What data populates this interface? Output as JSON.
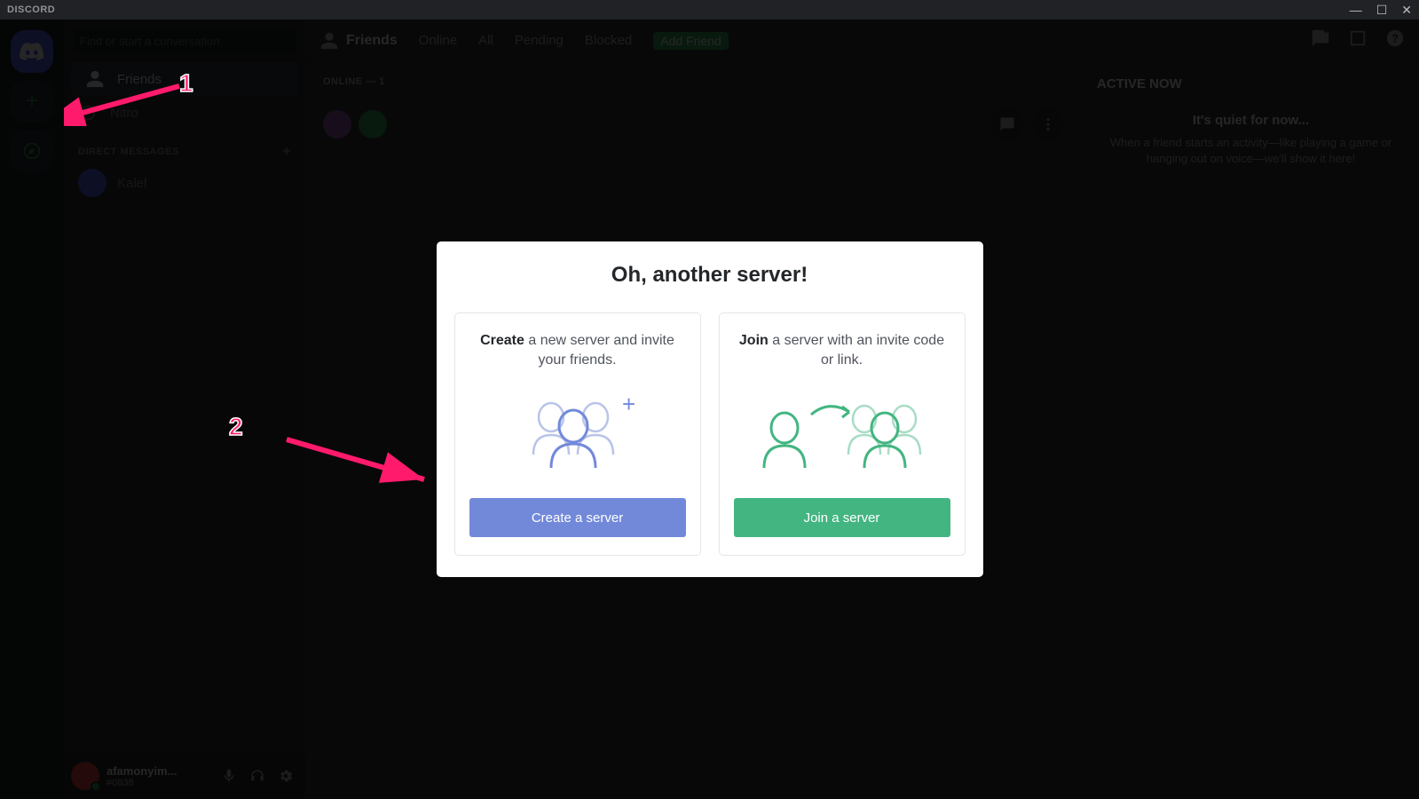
{
  "titlebar": {
    "title": "DISCORD"
  },
  "sidebar": {
    "search_placeholder": "Find or start a conversation",
    "friends_label": "Friends",
    "nitro_label": "Nitro",
    "dm_header": "DIRECT MESSAGES",
    "dm_items": [
      {
        "name": "Kalel"
      }
    ]
  },
  "user": {
    "name": "afamonyim...",
    "tag": "#0838"
  },
  "header": {
    "friends": "Friends",
    "tabs": {
      "online": "Online",
      "all": "All",
      "pending": "Pending",
      "blocked": "Blocked",
      "add": "Add Friend"
    }
  },
  "friends_section": {
    "label": "ONLINE — 1"
  },
  "activity": {
    "title": "ACTIVE NOW",
    "quiet": "It's quiet for now...",
    "desc": "When a friend starts an activity—like playing a game or hanging out on voice—we'll show it here!"
  },
  "modal": {
    "title": "Oh, another server!",
    "create": {
      "strong": "Create",
      "text": " a new server and invite your friends.",
      "button": "Create a server"
    },
    "join": {
      "strong": "Join",
      "text": " a server with an invite code or link.",
      "button": "Join a server"
    }
  },
  "annotations": {
    "n1": "1",
    "n2": "2"
  }
}
